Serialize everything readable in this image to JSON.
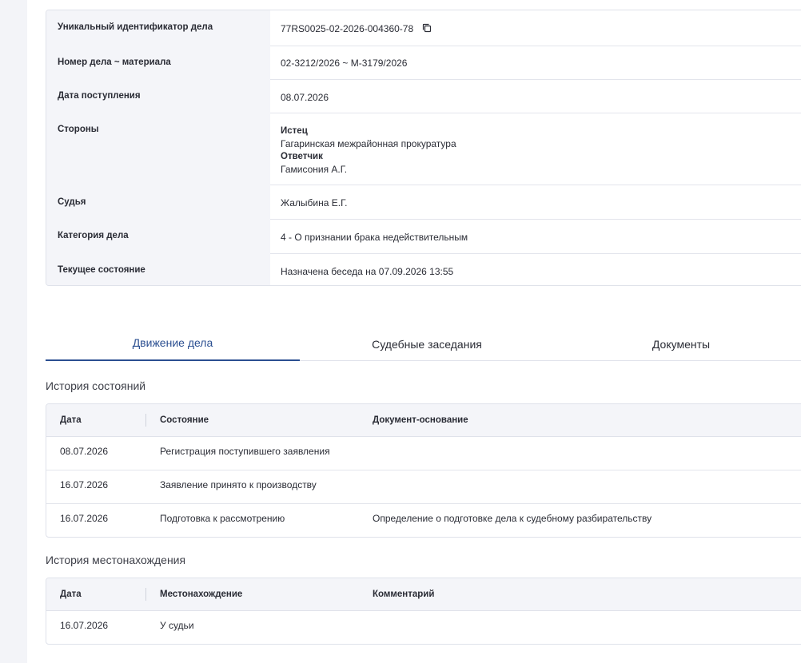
{
  "case_info": {
    "uid_label": "Уникальный идентификатор дела",
    "uid_value": "77RS0025-02-2026-004360-78",
    "number_label": "Номер дела ~ материала",
    "number_value": "02-3212/2026 ~ М-3179/2026",
    "date_label": "Дата поступления",
    "date_value": "08.07.2026",
    "parties_label": "Стороны",
    "plaintiff_role": "Истец",
    "plaintiff_name": "Гагаринская межрайонная прокуратура",
    "defendant_role": "Ответчик",
    "defendant_name": "Гамисония А.Г.",
    "judge_label": "Судья",
    "judge_value": "Жалыбина Е.Г.",
    "category_label": "Категория дела",
    "category_value": "4 - О признании брака недействительным",
    "status_label": "Текущее состояние",
    "status_value": "Назначена беседа на 07.09.2026 13:55"
  },
  "tabs": [
    {
      "label": "Движение дела",
      "active": true
    },
    {
      "label": "Судебные заседания",
      "active": false
    },
    {
      "label": "Документы",
      "active": false
    }
  ],
  "state_history": {
    "title": "История состояний",
    "headers": [
      "Дата",
      "Состояние",
      "Документ-основание"
    ],
    "rows": [
      [
        "08.07.2026",
        "Регистрация поступившего заявления",
        ""
      ],
      [
        "16.07.2026",
        "Заявление принято к производству",
        ""
      ],
      [
        "16.07.2026",
        "Подготовка к рассмотрению",
        "Определение о подготовке дела к судебному разбирательству"
      ]
    ]
  },
  "location_history": {
    "title": "История местонахождения",
    "headers": [
      "Дата",
      "Местонахождение",
      "Комментарий"
    ],
    "rows": [
      [
        "16.07.2026",
        "У судьи",
        ""
      ]
    ]
  },
  "colors": {
    "accent": "#2b4f91",
    "label_bg": "#f4f5f9",
    "border": "#dfe2ea"
  },
  "icons": {
    "copy": "copy-icon"
  }
}
